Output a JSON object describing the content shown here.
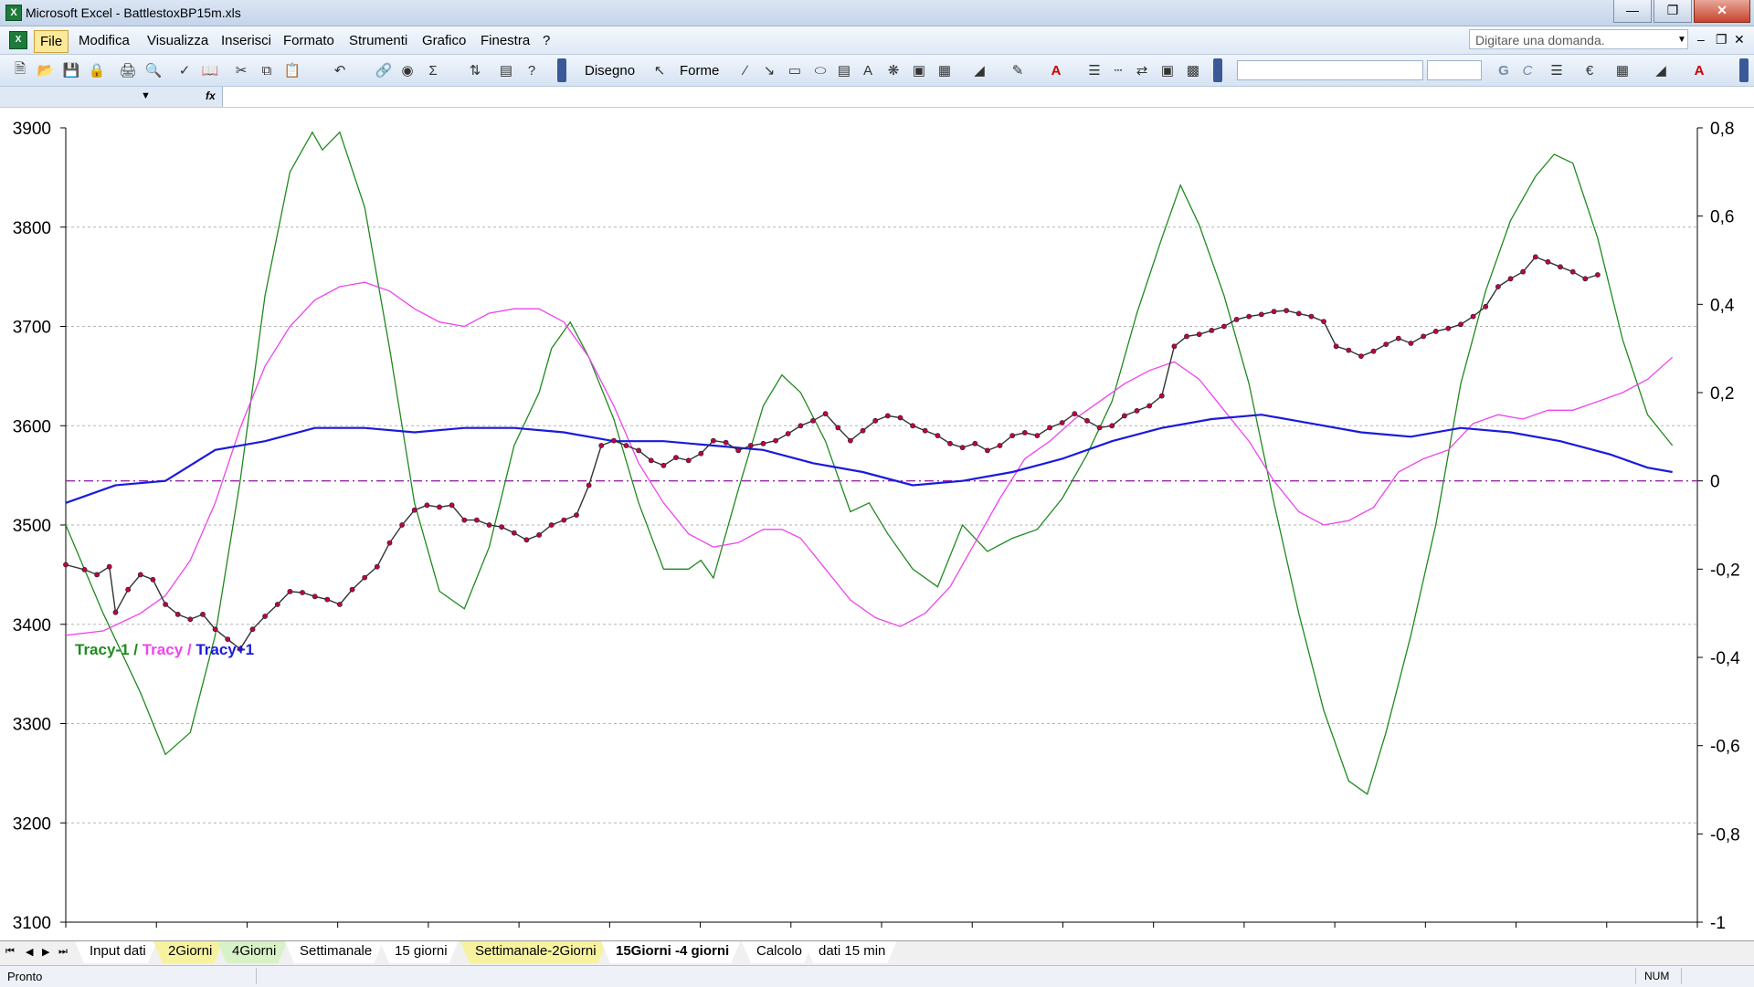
{
  "window": {
    "title": "Microsoft Excel - BattlestoxBP15m.xls"
  },
  "menu": {
    "items": [
      "File",
      "Modifica",
      "Visualizza",
      "Inserisci",
      "Formato",
      "Strumenti",
      "Grafico",
      "Finestra",
      "?"
    ],
    "help_placeholder": "Digitare una domanda."
  },
  "toolbar": {
    "draw_label": "Disegno",
    "shapes_label": "Forme"
  },
  "chart_data": {
    "type": "line",
    "legend_text": {
      "a": "Tracy-1",
      "sep1": " / ",
      "b": "Tracy",
      "sep2": " / ",
      "c": "Tracy+1"
    },
    "colors": {
      "tracy_minus_1": "#1f8a1f",
      "tracy": "#ee44ee",
      "tracy_plus_1": "#1a1adc",
      "price": "#c0004a",
      "zero_line": "#9a2aa8"
    },
    "y_left": {
      "min": 3100,
      "max": 3900,
      "ticks": [
        "3900",
        "3800",
        "3700",
        "3600",
        "3500",
        "3400",
        "3300",
        "3200",
        "3100"
      ]
    },
    "y_right": {
      "min": -1,
      "max": 0.8,
      "ticks": [
        "0,8",
        "0,6",
        "0,4",
        "0,2",
        "0",
        "-0,2",
        "-0,4",
        "-0,6",
        "-0,8",
        "-1"
      ]
    },
    "x_range": [
      0,
      100
    ],
    "zero_reference": 0,
    "series": [
      {
        "axis": "right",
        "color_key": "tracy_minus_1",
        "points": [
          [
            0,
            -0.1
          ],
          [
            3,
            -0.3
          ],
          [
            6,
            -0.48
          ],
          [
            8,
            -0.62
          ],
          [
            10,
            -0.57
          ],
          [
            12,
            -0.35
          ],
          [
            14,
            0.0
          ],
          [
            16,
            0.42
          ],
          [
            18,
            0.7
          ],
          [
            19.8,
            0.79
          ],
          [
            20.6,
            0.75
          ],
          [
            22,
            0.79
          ],
          [
            24,
            0.62
          ],
          [
            26,
            0.3
          ],
          [
            28,
            -0.05
          ],
          [
            30,
            -0.25
          ],
          [
            32,
            -0.29
          ],
          [
            34,
            -0.15
          ],
          [
            36,
            0.08
          ],
          [
            38,
            0.2
          ],
          [
            39,
            0.3
          ],
          [
            40.5,
            0.36
          ],
          [
            42,
            0.28
          ],
          [
            44,
            0.14
          ],
          [
            46,
            -0.05
          ],
          [
            48,
            -0.2
          ],
          [
            50,
            -0.2
          ],
          [
            51,
            -0.18
          ],
          [
            52,
            -0.22
          ],
          [
            54,
            -0.02
          ],
          [
            56,
            0.17
          ],
          [
            57.5,
            0.24
          ],
          [
            59,
            0.2
          ],
          [
            61,
            0.09
          ],
          [
            63,
            -0.07
          ],
          [
            64.5,
            -0.05
          ],
          [
            66,
            -0.12
          ],
          [
            68,
            -0.2
          ],
          [
            70,
            -0.24
          ],
          [
            72,
            -0.1
          ],
          [
            74,
            -0.16
          ],
          [
            76,
            -0.13
          ],
          [
            78,
            -0.11
          ],
          [
            80,
            -0.04
          ],
          [
            82,
            0.06
          ],
          [
            84,
            0.18
          ],
          [
            86,
            0.38
          ],
          [
            88,
            0.55
          ],
          [
            89.5,
            0.67
          ],
          [
            91,
            0.58
          ],
          [
            93,
            0.42
          ],
          [
            95,
            0.22
          ],
          [
            97,
            -0.05
          ],
          [
            99,
            -0.3
          ],
          [
            101,
            -0.52
          ],
          [
            103,
            -0.68
          ],
          [
            104.5,
            -0.71
          ],
          [
            106,
            -0.57
          ],
          [
            108,
            -0.35
          ],
          [
            110,
            -0.1
          ],
          [
            112,
            0.22
          ],
          [
            114,
            0.43
          ],
          [
            116,
            0.59
          ],
          [
            118,
            0.69
          ],
          [
            119.5,
            0.74
          ],
          [
            121,
            0.72
          ],
          [
            123,
            0.55
          ],
          [
            125,
            0.32
          ],
          [
            127,
            0.15
          ],
          [
            129,
            0.08
          ]
        ]
      },
      {
        "axis": "right",
        "color_key": "tracy",
        "points": [
          [
            0,
            -0.35
          ],
          [
            3,
            -0.34
          ],
          [
            6,
            -0.3
          ],
          [
            8,
            -0.26
          ],
          [
            10,
            -0.18
          ],
          [
            12,
            -0.05
          ],
          [
            14,
            0.12
          ],
          [
            16,
            0.26
          ],
          [
            18,
            0.35
          ],
          [
            20,
            0.41
          ],
          [
            22,
            0.44
          ],
          [
            24,
            0.45
          ],
          [
            26,
            0.43
          ],
          [
            28,
            0.39
          ],
          [
            30,
            0.36
          ],
          [
            32,
            0.35
          ],
          [
            34,
            0.38
          ],
          [
            36,
            0.39
          ],
          [
            38,
            0.39
          ],
          [
            40,
            0.36
          ],
          [
            42,
            0.28
          ],
          [
            44,
            0.17
          ],
          [
            46,
            0.04
          ],
          [
            48,
            -0.05
          ],
          [
            50,
            -0.12
          ],
          [
            52,
            -0.15
          ],
          [
            54,
            -0.14
          ],
          [
            56,
            -0.11
          ],
          [
            57.5,
            -0.11
          ],
          [
            59,
            -0.13
          ],
          [
            61,
            -0.2
          ],
          [
            63,
            -0.27
          ],
          [
            65,
            -0.31
          ],
          [
            67,
            -0.33
          ],
          [
            69,
            -0.3
          ],
          [
            71,
            -0.24
          ],
          [
            73,
            -0.14
          ],
          [
            75,
            -0.04
          ],
          [
            77,
            0.05
          ],
          [
            79,
            0.09
          ],
          [
            81,
            0.14
          ],
          [
            83,
            0.18
          ],
          [
            85,
            0.22
          ],
          [
            87,
            0.25
          ],
          [
            89,
            0.27
          ],
          [
            91,
            0.23
          ],
          [
            93,
            0.16
          ],
          [
            95,
            0.09
          ],
          [
            97,
            0.0
          ],
          [
            99,
            -0.07
          ],
          [
            101,
            -0.1
          ],
          [
            103,
            -0.09
          ],
          [
            105,
            -0.06
          ],
          [
            107,
            0.02
          ],
          [
            109,
            0.05
          ],
          [
            111,
            0.07
          ],
          [
            113,
            0.13
          ],
          [
            115,
            0.15
          ],
          [
            117,
            0.14
          ],
          [
            119,
            0.16
          ],
          [
            121,
            0.16
          ],
          [
            123,
            0.18
          ],
          [
            125,
            0.2
          ],
          [
            127,
            0.23
          ],
          [
            129,
            0.28
          ]
        ]
      },
      {
        "axis": "right",
        "color_key": "tracy_plus_1",
        "points": [
          [
            0,
            -0.05
          ],
          [
            4,
            -0.01
          ],
          [
            8,
            0.0
          ],
          [
            12,
            0.07
          ],
          [
            16,
            0.09
          ],
          [
            20,
            0.12
          ],
          [
            24,
            0.12
          ],
          [
            28,
            0.11
          ],
          [
            32,
            0.12
          ],
          [
            36,
            0.12
          ],
          [
            40,
            0.11
          ],
          [
            44,
            0.09
          ],
          [
            48,
            0.09
          ],
          [
            52,
            0.08
          ],
          [
            56,
            0.07
          ],
          [
            60,
            0.04
          ],
          [
            64,
            0.02
          ],
          [
            68,
            -0.01
          ],
          [
            72,
            0.0
          ],
          [
            76,
            0.02
          ],
          [
            80,
            0.05
          ],
          [
            84,
            0.09
          ],
          [
            88,
            0.12
          ],
          [
            92,
            0.14
          ],
          [
            96,
            0.15
          ],
          [
            100,
            0.13
          ],
          [
            104,
            0.11
          ],
          [
            108,
            0.1
          ],
          [
            112,
            0.12
          ],
          [
            116,
            0.11
          ],
          [
            120,
            0.09
          ],
          [
            124,
            0.06
          ],
          [
            127,
            0.03
          ],
          [
            129,
            0.02
          ]
        ]
      },
      {
        "axis": "left",
        "color_key": "price",
        "points": [
          [
            0,
            3460
          ],
          [
            1.5,
            3455
          ],
          [
            2.5,
            3450
          ],
          [
            3.5,
            3458
          ],
          [
            4,
            3412
          ],
          [
            5,
            3435
          ],
          [
            6,
            3450
          ],
          [
            7,
            3445
          ],
          [
            8,
            3420
          ],
          [
            9,
            3410
          ],
          [
            10,
            3405
          ],
          [
            11,
            3410
          ],
          [
            12,
            3395
          ],
          [
            13,
            3385
          ],
          [
            14,
            3375
          ],
          [
            15,
            3395
          ],
          [
            16,
            3408
          ],
          [
            17,
            3420
          ],
          [
            18,
            3433
          ],
          [
            19,
            3432
          ],
          [
            20,
            3428
          ],
          [
            21,
            3425
          ],
          [
            22,
            3420
          ],
          [
            23,
            3435
          ],
          [
            24,
            3447
          ],
          [
            25,
            3458
          ],
          [
            26,
            3482
          ],
          [
            27,
            3500
          ],
          [
            28,
            3515
          ],
          [
            29,
            3520
          ],
          [
            30,
            3518
          ],
          [
            31,
            3520
          ],
          [
            32,
            3505
          ],
          [
            33,
            3505
          ],
          [
            34,
            3500
          ],
          [
            35,
            3498
          ],
          [
            36,
            3492
          ],
          [
            37,
            3485
          ],
          [
            38,
            3490
          ],
          [
            39,
            3500
          ],
          [
            40,
            3505
          ],
          [
            41,
            3510
          ],
          [
            42,
            3540
          ],
          [
            43,
            3580
          ],
          [
            44,
            3585
          ],
          [
            45,
            3580
          ],
          [
            46,
            3575
          ],
          [
            47,
            3565
          ],
          [
            48,
            3560
          ],
          [
            49,
            3568
          ],
          [
            50,
            3565
          ],
          [
            51,
            3572
          ],
          [
            52,
            3585
          ],
          [
            53,
            3583
          ],
          [
            54,
            3575
          ],
          [
            55,
            3580
          ],
          [
            56,
            3582
          ],
          [
            57,
            3585
          ],
          [
            58,
            3592
          ],
          [
            59,
            3600
          ],
          [
            60,
            3605
          ],
          [
            61,
            3612
          ],
          [
            62,
            3598
          ],
          [
            63,
            3585
          ],
          [
            64,
            3595
          ],
          [
            65,
            3605
          ],
          [
            66,
            3610
          ],
          [
            67,
            3608
          ],
          [
            68,
            3600
          ],
          [
            69,
            3595
          ],
          [
            70,
            3590
          ],
          [
            71,
            3582
          ],
          [
            72,
            3578
          ],
          [
            73,
            3582
          ],
          [
            74,
            3575
          ],
          [
            75,
            3580
          ],
          [
            76,
            3590
          ],
          [
            77,
            3593
          ],
          [
            78,
            3590
          ],
          [
            79,
            3598
          ],
          [
            80,
            3603
          ],
          [
            81,
            3612
          ],
          [
            82,
            3605
          ],
          [
            83,
            3598
          ],
          [
            84,
            3600
          ],
          [
            85,
            3610
          ],
          [
            86,
            3615
          ],
          [
            87,
            3620
          ],
          [
            88,
            3630
          ],
          [
            89,
            3680
          ],
          [
            90,
            3690
          ],
          [
            91,
            3692
          ],
          [
            92,
            3696
          ],
          [
            93,
            3700
          ],
          [
            94,
            3707
          ],
          [
            95,
            3710
          ],
          [
            96,
            3712
          ],
          [
            97,
            3715
          ],
          [
            98,
            3716
          ],
          [
            99,
            3713
          ],
          [
            100,
            3710
          ],
          [
            101,
            3705
          ],
          [
            102,
            3680
          ],
          [
            103,
            3676
          ],
          [
            104,
            3670
          ],
          [
            105,
            3675
          ],
          [
            106,
            3682
          ],
          [
            107,
            3688
          ],
          [
            108,
            3683
          ],
          [
            109,
            3690
          ],
          [
            110,
            3695
          ],
          [
            111,
            3698
          ],
          [
            112,
            3702
          ],
          [
            113,
            3710
          ],
          [
            114,
            3720
          ],
          [
            115,
            3740
          ],
          [
            116,
            3748
          ],
          [
            117,
            3755
          ],
          [
            118,
            3770
          ],
          [
            119,
            3765
          ],
          [
            120,
            3760
          ],
          [
            121,
            3755
          ],
          [
            122,
            3748
          ],
          [
            123,
            3752
          ]
        ]
      }
    ]
  },
  "sheet_tabs": [
    "Input dati",
    "2Giorni",
    "4Giorni",
    "Settimanale",
    "15 giorni",
    "Settimanale-2Giorni",
    "15Giorni -4 giorni",
    "Calcolo",
    "dati 15 min"
  ],
  "status": {
    "text": "Pronto",
    "num": "NUM"
  }
}
